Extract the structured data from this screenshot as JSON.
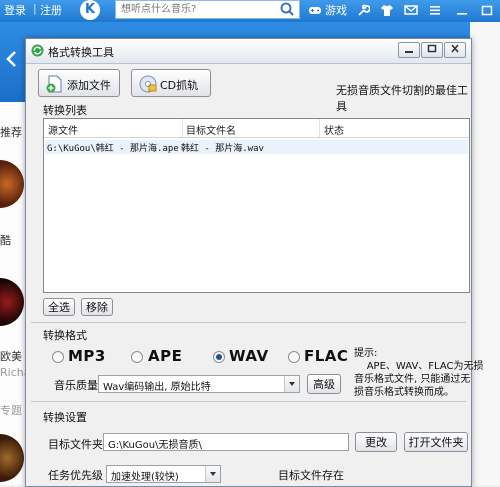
{
  "background": {
    "login": "登录",
    "register": "注册",
    "logo_letter": "K",
    "search_placeholder": "想听点什么音乐?",
    "games": "游戏",
    "side_texts": [
      "推荐",
      "酷",
      "欧美",
      "Richa",
      "专题"
    ]
  },
  "window": {
    "title": "格式转换工具",
    "tagline": "无损音质文件切割的最佳工具"
  },
  "toolbar": {
    "add_file": "添加文件",
    "cd_rip": "CD抓轨"
  },
  "convert_list": {
    "label": "转换列表",
    "columns": [
      "源文件",
      "目标文件名",
      "状态"
    ],
    "rows": [
      {
        "source": "G:\\KuGou\\韩红 - 那片海.ape",
        "target": "韩红 - 那片海.wav",
        "status": ""
      }
    ],
    "select_all": "全选",
    "remove": "移除"
  },
  "convert_format": {
    "label": "转换格式",
    "options": [
      "MP3",
      "APE",
      "WAV",
      "FLAC"
    ],
    "selected": "WAV",
    "quality_label": "音乐质量",
    "quality_value": "Wav编码输出, 原始比特",
    "advanced": "高级",
    "hint": "提示:\n    APE、WAV、FLAC为无损\n音乐格式文件, 只能通过无\n损音乐格式转换而成。"
  },
  "convert_settings": {
    "label": "转换设置",
    "target_folder_label": "目标文件夹",
    "target_folder_value": "G:\\KuGou\\无损音质\\",
    "change_button": "更改",
    "open_folder_button": "打开文件夹",
    "priority_label": "任务优先级",
    "priority_value": "加速处理(较快)",
    "exists_label": "目标文件存在"
  },
  "colors": {
    "brand_blue": "#1f78d0",
    "selection": "#eaf2fb"
  }
}
